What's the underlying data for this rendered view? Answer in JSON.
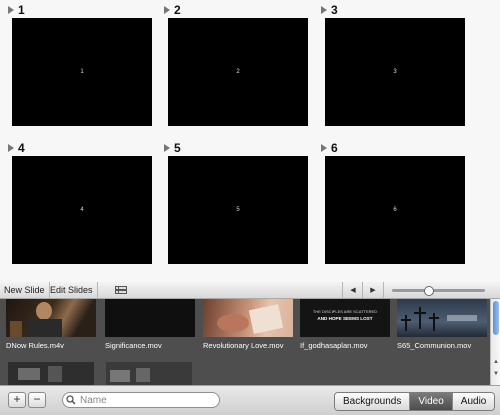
{
  "slides": [
    {
      "number": "1",
      "thumb_label": "1"
    },
    {
      "number": "2",
      "thumb_label": "2"
    },
    {
      "number": "3",
      "thumb_label": "3"
    },
    {
      "number": "4",
      "thumb_label": "4"
    },
    {
      "number": "5",
      "thumb_label": "5"
    },
    {
      "number": "6",
      "thumb_label": "6"
    }
  ],
  "toolbar": {
    "new_slide_label": "New Slide",
    "edit_slides_label": "Edit Slides",
    "view_icon": "grid-view-icon",
    "prev_icon": "chevron-left-icon",
    "next_icon": "chevron-right-icon",
    "zoom_level": 0.4
  },
  "media": {
    "items": [
      {
        "name": "DNow Rules.m4v",
        "thumb_color": "#2b2118"
      },
      {
        "name": "Significance.mov",
        "thumb_color": "#111111"
      },
      {
        "name": "Revolutionary Love.mov",
        "thumb_color": "#c49077"
      },
      {
        "name": "If_godhasaplan.mov",
        "thumb_color": "#1a1a1a"
      },
      {
        "name": "S65_Communion.mov",
        "thumb_color": "#3a4758"
      }
    ],
    "row2": [
      {
        "thumb_color": "#2e2e2e"
      },
      {
        "thumb_color": "#3a3a3a"
      }
    ],
    "thumb_texts": {
      "item4_line1": "THE DISCIPLES ARE SCATTERED",
      "item4_line2": "AND HOPE SEEMS LOST"
    }
  },
  "bottom": {
    "add_label": "+",
    "remove_label": "−",
    "search_placeholder": "Name",
    "tabs": [
      {
        "label": "Backgrounds",
        "active": false
      },
      {
        "label": "Video",
        "active": true
      },
      {
        "label": "Audio",
        "active": false
      }
    ]
  },
  "colors": {
    "accent": "#5a8fd8",
    "media_bg": "#4e4e4e",
    "active_tab": "#5a5a5a"
  }
}
